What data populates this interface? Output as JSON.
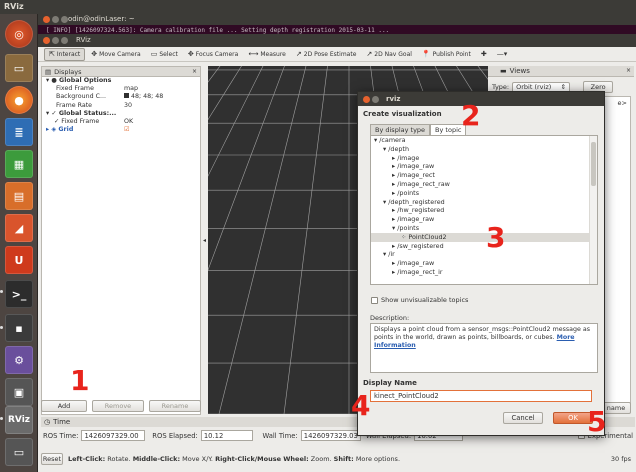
{
  "top_panel": {
    "title": "RViz"
  },
  "terminal": {
    "title": "odin@odinLaser: ~",
    "text": "[ INFO] [1426097324.563]: Camera calibration file ... Setting depth registration 2015-03-11 ..."
  },
  "rviz": {
    "title": "RViz",
    "toolbar": [
      {
        "label": "Interact",
        "icon": "interact-icon",
        "symbol": "⇱",
        "active": true
      },
      {
        "label": "Move Camera",
        "icon": "move-camera-icon",
        "symbol": "✥"
      },
      {
        "label": "Select",
        "icon": "select-icon",
        "symbol": "▭"
      },
      {
        "label": "Focus Camera",
        "icon": "focus-camera-icon",
        "symbol": "✥"
      },
      {
        "label": "Measure",
        "icon": "measure-icon",
        "symbol": "⟷"
      },
      {
        "label": "2D Pose Estimate",
        "icon": "pose-estimate-icon",
        "symbol": "↗"
      },
      {
        "label": "2D Nav Goal",
        "icon": "nav-goal-icon",
        "symbol": "↗"
      },
      {
        "label": "Publish Point",
        "icon": "publish-point-icon",
        "symbol": "📍"
      },
      {
        "label": "",
        "icon": "add-tool-icon",
        "symbol": "✚"
      },
      {
        "label": "",
        "icon": "tool-menu-icon",
        "symbol": "—▾"
      }
    ],
    "displays": {
      "title": "Displays",
      "rows": [
        {
          "key": "▾ ● Global Options",
          "val": ""
        },
        {
          "key": "Fixed Frame",
          "val": "map"
        },
        {
          "key": "Background C...",
          "val": "48; 48; 48"
        },
        {
          "key": "Frame Rate",
          "val": "30"
        },
        {
          "key": "▾ ✓ Global Status:...",
          "val": ""
        },
        {
          "key": "✓ Fixed Frame",
          "val": "OK"
        },
        {
          "key": "▸ ◈ Grid",
          "val": "☑"
        }
      ],
      "buttons": {
        "add": "Add",
        "remove": "Remove",
        "rename": "Rename"
      }
    },
    "views": {
      "title": "Views",
      "type_label": "Type:",
      "type_value": "Orbit (rviz)",
      "zero": "Zero",
      "rename": "name"
    },
    "time": {
      "title": "Time",
      "ros_time_label": "ROS Time:",
      "ros_time": "1426097329.00",
      "ros_elapsed_label": "ROS Elapsed:",
      "ros_elapsed": "10.12",
      "wall_time_label": "Wall Time:",
      "wall_time": "1426097329.03",
      "wall_elapsed_label": "Wall Elapsed:",
      "wall_elapsed": "10.02",
      "experimental": "Experimental"
    },
    "status": {
      "reset": "Reset",
      "left_click": "Left-Click:",
      "left_click_action": "Rotate.",
      "middle_click": "Middle-Click:",
      "middle_click_action": "Move X/Y.",
      "right_click": "Right-Click/Mouse Wheel:",
      "right_click_action": "Zoom.",
      "shift": "Shift:",
      "shift_action": "More options.",
      "fps": "30 fps"
    }
  },
  "dialog": {
    "title": "rviz",
    "heading": "Create visualization",
    "tabs": [
      "By display type",
      "By topic"
    ],
    "tree": [
      {
        "text": "▾ /camera",
        "level": 0
      },
      {
        "text": "▾ /depth",
        "level": 1
      },
      {
        "text": "▸ /image",
        "level": 2
      },
      {
        "text": "▸ /image_raw",
        "level": 2
      },
      {
        "text": "▸ /image_rect",
        "level": 2
      },
      {
        "text": "▸ /image_rect_raw",
        "level": 2
      },
      {
        "text": "▸ /points",
        "level": 2
      },
      {
        "text": "▾ /depth_registered",
        "level": 1
      },
      {
        "text": "▸ /hw_registered",
        "level": 2
      },
      {
        "text": "▸ /image_raw",
        "level": 2
      },
      {
        "text": "▾ /points",
        "level": 2
      },
      {
        "text": "⁘ PointCloud2",
        "level": 3,
        "selected": true
      },
      {
        "text": "▸ /sw_registered",
        "level": 2
      },
      {
        "text": "▾ /ir",
        "level": 1
      },
      {
        "text": "▸ /image_raw",
        "level": 2
      },
      {
        "text": "▸ /image_rect_ir",
        "level": 2
      }
    ],
    "show_unvisualizable": "Show unvisualizable topics",
    "description_label": "Description:",
    "description": "Displays a point cloud from a sensor_msgs::PointCloud2 message as points in the world, drawn as points, billboards, or cubes.",
    "more_info": "More Information",
    "display_name_label": "Display Name",
    "display_name": "kinect_PointCloud2",
    "cancel": "Cancel",
    "ok": "OK"
  },
  "annotations": [
    "1",
    "2",
    "3",
    "4",
    "5"
  ],
  "colors": {
    "accent": "#e3713a",
    "annotation": "#e8241c",
    "viewport_bg": "#303030",
    "grid": "#a0a0a0"
  }
}
